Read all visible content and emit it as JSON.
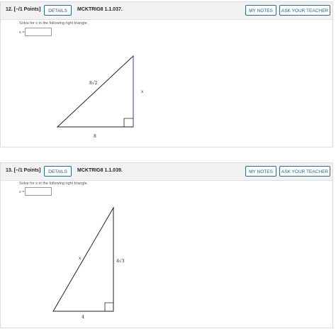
{
  "questions": [
    {
      "number_label": "12. [–/1 Points]",
      "details_label": "DETAILS",
      "code": "MCKTRIG8 1.1.037.",
      "my_notes_label": "MY NOTES",
      "ask_teacher_label": "ASK YOUR TEACHER",
      "prompt": "Solve for x in the following right triangle.",
      "answer_label": "x =",
      "answer_value": "",
      "figure": {
        "hypotenuse_label": "8√2",
        "vertical_side_label": "x",
        "base_label": "8"
      }
    },
    {
      "number_label": "13. [–/1 Points]",
      "details_label": "DETAILS",
      "code": "MCKTRIG8 1.1.039.",
      "my_notes_label": "MY NOTES",
      "ask_teacher_label": "ASK YOUR TEACHER",
      "prompt": "Solve for x in the following right triangle.",
      "answer_label": "x =",
      "answer_value": "",
      "figure": {
        "hypotenuse_label": "x",
        "vertical_side_label": "4√3",
        "base_label": "4"
      }
    }
  ]
}
